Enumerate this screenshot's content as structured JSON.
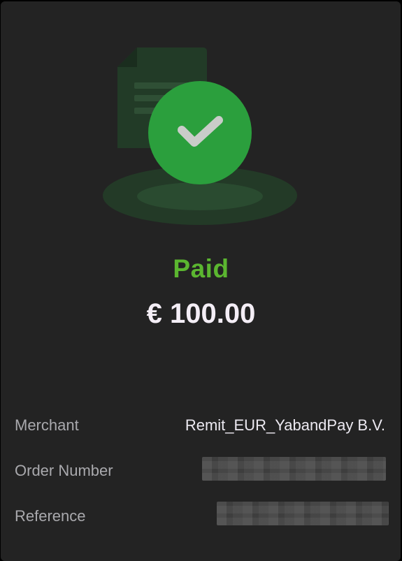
{
  "payment": {
    "status": "Paid",
    "amount": "€ 100.00"
  },
  "details": {
    "merchant": {
      "label": "Merchant",
      "value": "Remit_EUR_YabandPay B.V."
    },
    "order_number": {
      "label": "Order Number",
      "value": ""
    },
    "reference": {
      "label": "Reference",
      "value": ""
    }
  },
  "icons": {
    "illustration": "document-check-icon",
    "check": "check-icon"
  },
  "colors": {
    "background": "#232323",
    "status_green": "#5bb630",
    "badge_green": "#2b9f3d",
    "amount_text": "#f4eef6",
    "label_text": "#a9a9ad"
  }
}
